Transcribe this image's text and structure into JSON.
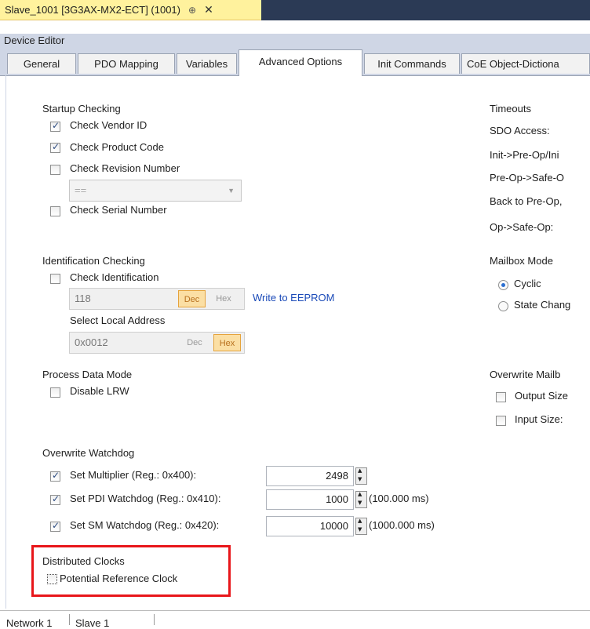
{
  "document_tab": {
    "title": "Slave_1001 [3G3AX-MX2-ECT] (1001)",
    "pin": "⊕",
    "close": "✕"
  },
  "editor": {
    "title": "Device Editor"
  },
  "tabs": [
    "General",
    "PDO Mapping",
    "Variables",
    "Advanced Options",
    "Init Commands",
    "CoE Object-Dictiona"
  ],
  "active_tab": "Advanced Options",
  "startup": {
    "heading": "Startup Checking",
    "vendor": "Check Vendor ID",
    "product": "Check Product Code",
    "revision": "Check Revision Number",
    "revision_select": "==",
    "serial": "Check Serial Number"
  },
  "identification": {
    "heading": "Identification Checking",
    "check": "Check Identification",
    "value": "118",
    "dec": "Dec",
    "hex": "Hex",
    "write": "Write to EEPROM",
    "local_label": "Select Local Address",
    "local_value": "0x0012"
  },
  "process": {
    "heading": "Process Data Mode",
    "lrw": "Disable LRW"
  },
  "watchdog": {
    "heading": "Overwrite Watchdog",
    "multiplier": "Set Multiplier (Reg.: 0x400):",
    "multiplier_value": "2498",
    "pdi": "Set PDI Watchdog (Reg.: 0x410):",
    "pdi_value": "1000",
    "pdi_ms": "(100.000 ms)",
    "sm": "Set SM Watchdog (Reg.: 0x420):",
    "sm_value": "10000",
    "sm_ms": "(1000.000 ms)"
  },
  "dc": {
    "heading": "Distributed Clocks",
    "ref": "Potential Reference Clock"
  },
  "timeouts": {
    "heading": "Timeouts",
    "sdo": "SDO Access:",
    "init": "Init->Pre-Op/Ini",
    "preop": "Pre-Op->Safe-O",
    "back": "Back to Pre-Op,",
    "op": "Op->Safe-Op:"
  },
  "mailbox": {
    "heading": "Mailbox Mode",
    "cyclic": "Cyclic",
    "state": "State Chang"
  },
  "overwrite_mailbox": {
    "heading": "Overwrite Mailb",
    "output": "Output Size",
    "input": "Input Size:"
  },
  "status": {
    "left": "Network 1",
    "right": "Slave 1"
  },
  "colors": {
    "highlight_box": "#e8161a",
    "selected_button": "#fbdfa4",
    "tab_header": "#fff29d"
  }
}
